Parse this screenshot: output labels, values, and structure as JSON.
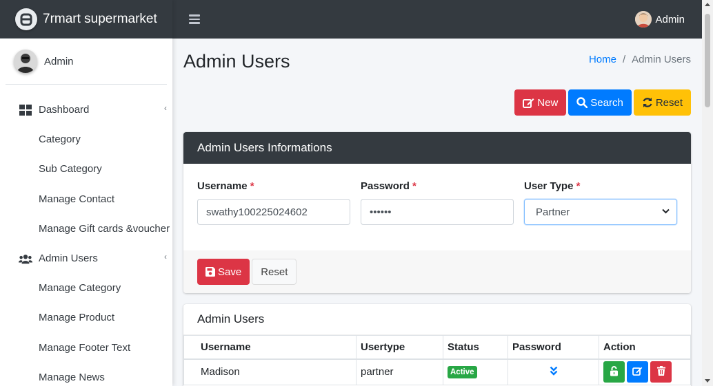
{
  "brand": {
    "title": "7rmart supermarket",
    "logo_icon": "brand-logo-icon"
  },
  "sidebar": {
    "user_name": "Admin",
    "items": [
      {
        "label": "Dashboard",
        "icon": "dashboard-icon",
        "caret": "‹"
      },
      {
        "label": "Category"
      },
      {
        "label": "Sub Category"
      },
      {
        "label": "Manage Contact"
      },
      {
        "label": "Manage Gift cards &voucher"
      },
      {
        "label": "Admin Users",
        "icon": "users-icon",
        "caret": "‹"
      },
      {
        "label": "Manage Category"
      },
      {
        "label": "Manage Product"
      },
      {
        "label": "Manage Footer Text"
      },
      {
        "label": "Manage News"
      }
    ]
  },
  "topbar": {
    "user_name": "Admin"
  },
  "page": {
    "title": "Admin Users",
    "breadcrumb": {
      "home": "Home",
      "separator": "/",
      "current": "Admin Users"
    }
  },
  "actions": {
    "new": "New",
    "search": "Search",
    "reset": "Reset"
  },
  "form": {
    "header": "Admin Users Informations",
    "username_label": "Username",
    "password_label": "Password",
    "usertype_label": "User Type",
    "required_mark": "*",
    "username_value": "swathy100225024602",
    "password_value": "••••••",
    "usertype_value": "Partner",
    "save": "Save",
    "reset": "Reset"
  },
  "table": {
    "title": "Admin Users",
    "columns": [
      "Username",
      "Usertype",
      "Status",
      "Password",
      "Action"
    ],
    "rows": [
      {
        "username": "Madison",
        "usertype": "partner",
        "status": "Active"
      }
    ]
  },
  "colors": {
    "dark": "#343a40",
    "primary": "#007bff",
    "danger": "#dc3545",
    "warning": "#ffc107",
    "success": "#28a745"
  }
}
